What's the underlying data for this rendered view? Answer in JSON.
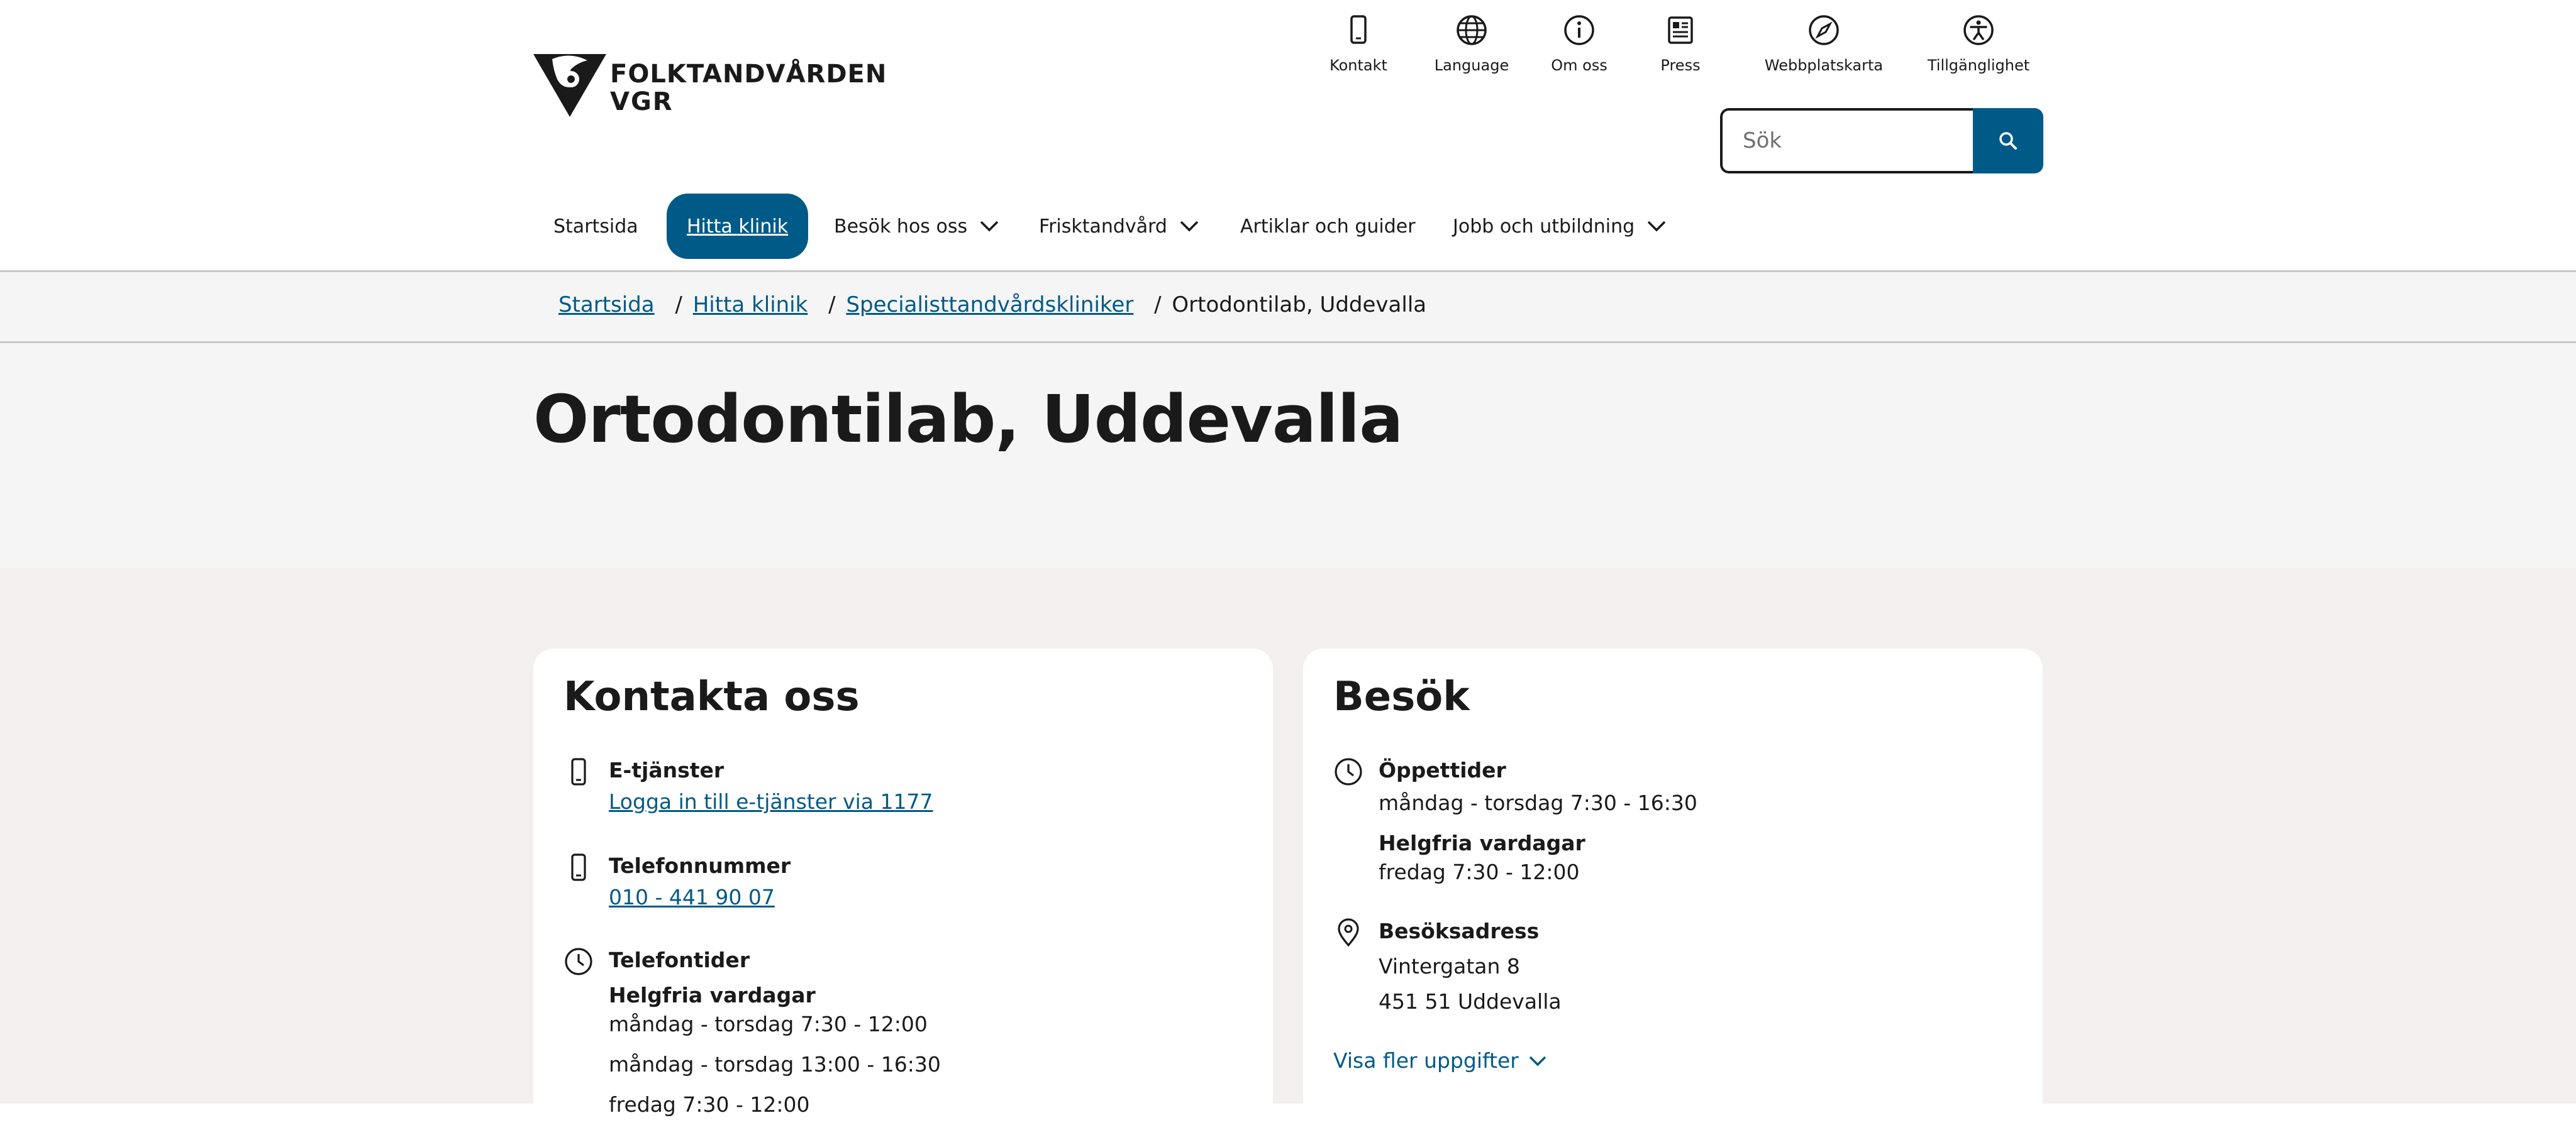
{
  "brand": {
    "line1": "FOLKTANDVÅRDEN",
    "line2": "VGR"
  },
  "utility_nav": [
    {
      "label": "Kontakt",
      "icon": "phone-icon"
    },
    {
      "label": "Language",
      "icon": "globe-icon"
    },
    {
      "label": "Om oss",
      "icon": "info-icon"
    },
    {
      "label": "Press",
      "icon": "newspaper-icon"
    },
    {
      "label": "Webbplatskarta",
      "icon": "compass-icon"
    },
    {
      "label": "Tillgänglighet",
      "icon": "accessibility-icon"
    }
  ],
  "search": {
    "placeholder": "Sök",
    "button_icon": "search-icon"
  },
  "main_nav": [
    {
      "label": "Startsida"
    },
    {
      "label": "Hitta klinik",
      "active": true
    },
    {
      "label": "Besök hos oss",
      "has_dropdown": true
    },
    {
      "label": "Frisktandvård",
      "has_dropdown": true
    },
    {
      "label": "Artiklar och guider"
    },
    {
      "label": "Jobb och utbildning",
      "has_dropdown": true
    }
  ],
  "breadcrumb": {
    "items": [
      "Startsida",
      "Hitta klinik",
      "Specialisttandvårdskliniker"
    ],
    "current": "Ortodontilab, Uddevalla",
    "separator": "/"
  },
  "page": {
    "title": "Ortodontilab, Uddevalla"
  },
  "contact_card": {
    "title": "Kontakta oss",
    "eservices": {
      "heading": "E-tjänster",
      "link": "Logga in till e-tjänster via 1177"
    },
    "phone": {
      "heading": "Telefonnummer",
      "number": "010 - 441 90 07"
    },
    "phone_hours": {
      "heading": "Telefontider",
      "subheading": "Helgfria vardagar",
      "lines": [
        "måndag - torsdag 7:30 - 12:00",
        "måndag - torsdag 13:00 - 16:30",
        "fredag 7:30 - 12:00"
      ]
    }
  },
  "visit_card": {
    "title": "Besök",
    "opening": {
      "heading": "Öppettider",
      "line1": "måndag - torsdag 7:30 - 16:30",
      "subheading": "Helgfria vardagar",
      "line2": "fredag 7:30 - 12:00"
    },
    "address": {
      "heading": "Besöksadress",
      "street": "Vintergatan 8",
      "city": "451 51 Uddevalla"
    },
    "more_link": "Visa fler uppgifter"
  },
  "colors": {
    "accent": "#005a87",
    "page_bg": "#f3efee",
    "band_bg": "#f5f5f5",
    "text": "#1a1a1a"
  }
}
